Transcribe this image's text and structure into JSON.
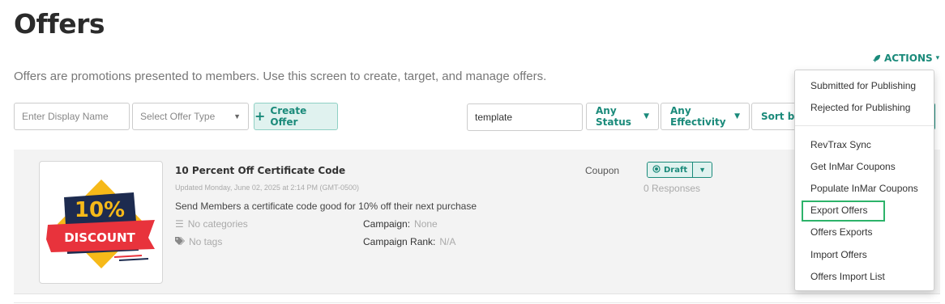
{
  "header": {
    "title": "Offers",
    "description": "Offers are promotions presented to members. Use this screen to create, target, and manage offers.",
    "actions_label": "ACTIONS"
  },
  "toolbar": {
    "display_name_placeholder": "Enter Display Name",
    "offer_type_placeholder": "Select Offer Type",
    "create_label": "Create Offer",
    "search_value": "template",
    "status_label": "Any Status",
    "effectivity_label": "Any Effectivity",
    "sort_label": "Sort by"
  },
  "offer": {
    "title": "10 Percent Off Certificate Code",
    "updated": "Updated Monday, June 02, 2025 at 2:14 PM (GMT-0500)",
    "description": "Send Members a certificate code good for 10% off their next purchase",
    "categories": "No categories",
    "tags": "No tags",
    "campaign_label": "Campaign:",
    "campaign_value": "None",
    "campaign_rank_label": "Campaign Rank:",
    "campaign_rank_value": "N/A",
    "type": "Coupon",
    "status": "Draft",
    "responses": "0 Responses",
    "thumbnail": {
      "percent": "10%",
      "word": "DISCOUNT"
    }
  },
  "actions_menu": {
    "items": [
      "Submitted for Publishing",
      "Rejected for Publishing",
      "RevTrax Sync",
      "Get InMar Coupons",
      "Populate InMar Coupons",
      "Export Offers",
      "Offers Exports",
      "Import Offers",
      "Offers Import List"
    ],
    "highlighted": "Export Offers"
  },
  "colors": {
    "accent": "#1a8a7a",
    "highlight": "#2db36a",
    "thumb_navy": "#1d2b4f",
    "thumb_red": "#e8333c",
    "thumb_yellow": "#f6b919"
  }
}
